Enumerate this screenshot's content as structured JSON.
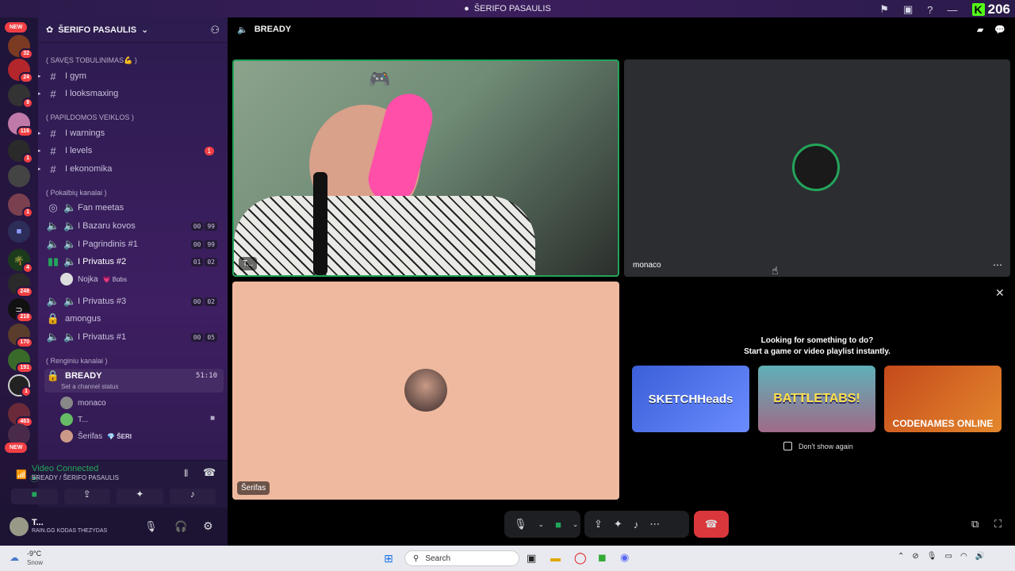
{
  "window": {
    "title": "ŠERIFO PASAULIS",
    "viewer_count": "206",
    "kick_label": "K"
  },
  "server": {
    "name": "ŠERIFO PASAULIS"
  },
  "guild_badges": [
    {
      "label": "NEW"
    },
    {
      "label": "32"
    },
    {
      "label": "24"
    },
    {
      "label": "9"
    },
    {
      "label": "116"
    },
    {
      "label": "1"
    },
    {
      "label": "1"
    },
    {
      "label": "4"
    },
    {
      "label": "248"
    },
    {
      "label": "218"
    },
    {
      "label": "170"
    },
    {
      "label": "191"
    },
    {
      "label": "1"
    },
    {
      "label": "463"
    },
    {
      "label": "NEW"
    }
  ],
  "categories": {
    "c1": "( SAVĘS TOBULINIMAS💪 )",
    "c2": "( PAPILDOMOS VEIKLOS )",
    "c3": "( Pokalbių kanalai )",
    "c4": "( Renginiu kanalai )"
  },
  "channels": {
    "gym": "I gym",
    "looks": "I looksmaxing",
    "warnings": "I warnings",
    "levels": "I levels",
    "levels_badge": "1",
    "ekonomika": "I ekonomika",
    "fan": "Fan meetas",
    "bazaru": "I Bazaru kovos",
    "bazaru_c": [
      "00",
      "99"
    ],
    "pag": "I Pagrindinis #1",
    "pag_c": [
      "00",
      "99"
    ],
    "priv2": "I Privatus #2",
    "priv2_c": [
      "01",
      "02"
    ],
    "nojka": "Nojka",
    "nojka_tag": "💗 Bɑbs",
    "priv3": "I Privatus #3",
    "priv3_c": [
      "00",
      "02"
    ],
    "amongus": "amongus",
    "priv1": "I Privatus #1",
    "priv1_c": [
      "00",
      "05"
    ],
    "bready": "BREADY",
    "bready_timer": "51:10",
    "bready_status": "Set a channel status",
    "m1": "monaco",
    "m2": "T...",
    "m3": "Šerifas",
    "m3_tag": "💎 ŠERI"
  },
  "voice": {
    "status": "Video Connected",
    "location": "BREADY / ŠERIFO PASAULIS"
  },
  "user": {
    "name": "T...",
    "status": "RAIN.GG KODAS THEZYDAS"
  },
  "main": {
    "channel": "BREADY",
    "tile1_name": "T...",
    "tile2_name": "monaco",
    "tile3_name": "Šerifas"
  },
  "activity": {
    "title": "Looking for something to do?",
    "subtitle": "Start a game or video playlist instantly.",
    "dont_show": "Don't show again",
    "games": [
      "SKETCHHeads",
      "BATTLETABS!",
      "CODENAMES ONLINE"
    ]
  },
  "taskbar": {
    "weather_temp": "-9°C",
    "weather_desc": "Snow",
    "search": "Search"
  },
  "colors": {
    "accent": "#5865f2",
    "danger": "#da373c",
    "speaking": "#23a55a"
  }
}
